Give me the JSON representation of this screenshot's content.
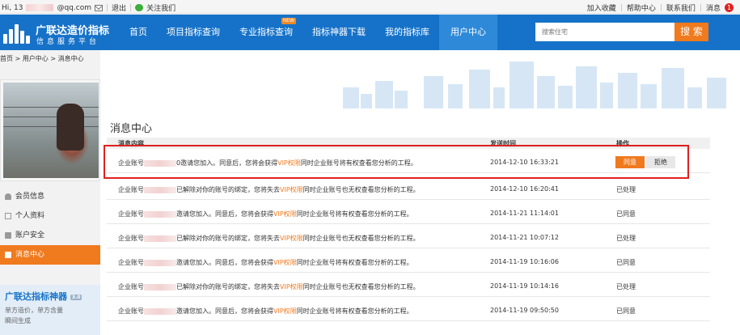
{
  "topbar": {
    "greeting": "Hi, 13",
    "email_suffix": "@qq.com",
    "logout": "退出",
    "follow": "关注我们",
    "favorite": "加入收藏",
    "help": "帮助中心",
    "contact": "联系我们",
    "messages": "消息",
    "message_count": "1"
  },
  "logo": {
    "title": "广联达造价指标",
    "subtitle": "信息服务平台"
  },
  "nav": {
    "items": [
      "首页",
      "项目指标查询",
      "专业指标查询",
      "指标神器下载",
      "我的指标库",
      "用户中心"
    ],
    "new_tag": "NEW",
    "search_placeholder": "搜索住宅",
    "search_button": "搜 索"
  },
  "breadcrumb": "首页 > 用户中心 > 消息中心",
  "sidebar": {
    "menu": [
      "会员信息",
      "个人资料",
      "账户安全",
      "消息中心"
    ],
    "promo_title": "广联达指标神器",
    "promo_version": "3.0",
    "promo_line1": "单方造价，单方含量",
    "promo_line2": "瞬间生成"
  },
  "panel": {
    "title": "消息中心",
    "columns": [
      "消息内容",
      "发送时间",
      "操作"
    ],
    "agree": "同意",
    "reject": "拒绝",
    "rows": [
      {
        "prefix": "企业账号",
        "after": "0邀请您加入。同意后，您将会获得",
        "vip": "VIP权限",
        "tail": "同时企业账号将有权查看您分析的工程。",
        "time": "2014-12-10 16:33:21",
        "status": ""
      },
      {
        "prefix": "企业账号",
        "after": "已解除对你的账号的绑定，您将失去",
        "vip": "VIP权限",
        "tail": "同时企业账号也无权查看您分析的工程。",
        "time": "2014-12-10 16:20:41",
        "status": "已处理"
      },
      {
        "prefix": "企业账号",
        "after": "邀请您加入。同意后，您将会获得",
        "vip": "VIP权限",
        "tail": "同时企业账号将有权查看您分析的工程。",
        "time": "2014-11-21 11:14:01",
        "status": "已同意"
      },
      {
        "prefix": "企业账号",
        "after": "已解除对你的账号的绑定，您将失去",
        "vip": "VIP权限",
        "tail": "同时企业账号也无权查看您分析的工程。",
        "time": "2014-11-21 10:07:12",
        "status": "已处理"
      },
      {
        "prefix": "企业账号",
        "after": "邀请您加入。同意后，您将会获得",
        "vip": "VIP权限",
        "tail": "同时企业账号将有权查看您分析的工程。",
        "time": "2014-11-19 10:16:06",
        "status": "已同意"
      },
      {
        "prefix": "企业账号",
        "after": "已解除对你的账号的绑定，您将失去",
        "vip": "VIP权限",
        "tail": "同时企业账号也无权查看您分析的工程。",
        "time": "2014-11-19 10:14:16",
        "status": "已处理"
      },
      {
        "prefix": "企业账号",
        "after": "邀请您加入。同意后，您将会获得",
        "vip": "VIP权限",
        "tail": "同时企业账号将有权查看您分析的工程。",
        "time": "2014-11-19 09:50:50",
        "status": "已同意"
      }
    ]
  }
}
